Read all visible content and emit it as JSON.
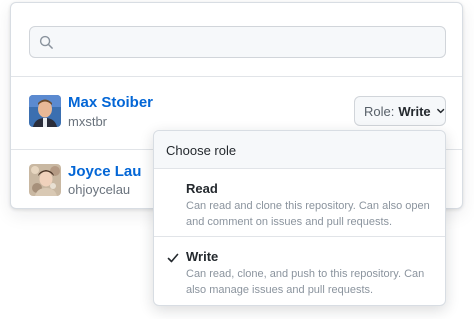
{
  "search": {
    "placeholder": "",
    "value": ""
  },
  "members": [
    {
      "name": "Max Stoiber",
      "login": "mxstbr",
      "role_prefix": "Role:",
      "role_value": "Write"
    },
    {
      "name": "Joyce Lau",
      "login": "ohjoycelau"
    }
  ],
  "role_menu": {
    "title": "Choose role",
    "items": [
      {
        "label": "Read",
        "description": "Can read and clone this repository. Can also open and comment on issues and pull requests.",
        "selected": false
      },
      {
        "label": "Write",
        "description": "Can read, clone, and push to this repository. Can also manage issues and pull requests.",
        "selected": true
      }
    ]
  },
  "colors": {
    "link": "#0366d6",
    "muted": "#6a737d",
    "border": "#d1d5da",
    "subtle_bg": "#f6f8fa"
  },
  "icons": {
    "search": "search-icon",
    "dropdown": "chevron-down-icon",
    "check": "check-icon"
  }
}
